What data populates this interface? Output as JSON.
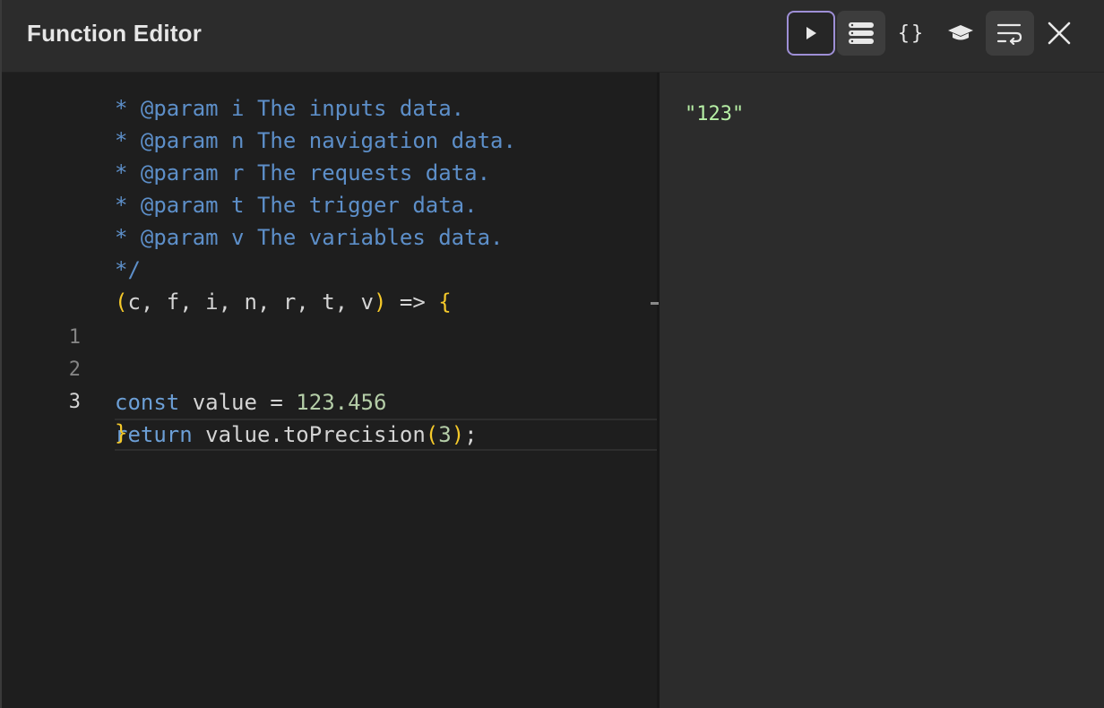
{
  "header": {
    "title": "Function Editor"
  },
  "toolbar": {
    "run": "play-icon",
    "layout": "stack-icon",
    "format_label": "{}",
    "hat": "graduation-cap-icon",
    "wrap": "wrap-icon",
    "close": "close-icon"
  },
  "editor": {
    "comment_lines": [
      "* @param i The inputs data.",
      "* @param n The navigation data.",
      "* @param r The requests data.",
      "* @param t The trigger data.",
      "* @param v The variables data.",
      "*/"
    ],
    "signature_open": "(",
    "signature_params": "c, f, i, n, r, t, v",
    "signature_close": ")",
    "signature_arrow": " => ",
    "signature_brace": "{",
    "line_numbers": [
      "1",
      "2",
      "3"
    ],
    "line2_keyword": "const",
    "line2_rest": " value = ",
    "line2_number": "123.456",
    "line3_keyword": "return",
    "line3_rest": " value.toPrecision",
    "line3_paren_open": "(",
    "line3_arg": "3",
    "line3_paren_close": ")",
    "line3_end": ";",
    "closing_brace": "}"
  },
  "output": {
    "value": "\"123\""
  },
  "colors": {
    "comment": "#5d8fc9",
    "keyword": "#6c9fd6",
    "number": "#b5cea8",
    "bracket": "#f5c92a",
    "output_string": "#b7f0a6",
    "run_border": "#9e8fd6"
  }
}
